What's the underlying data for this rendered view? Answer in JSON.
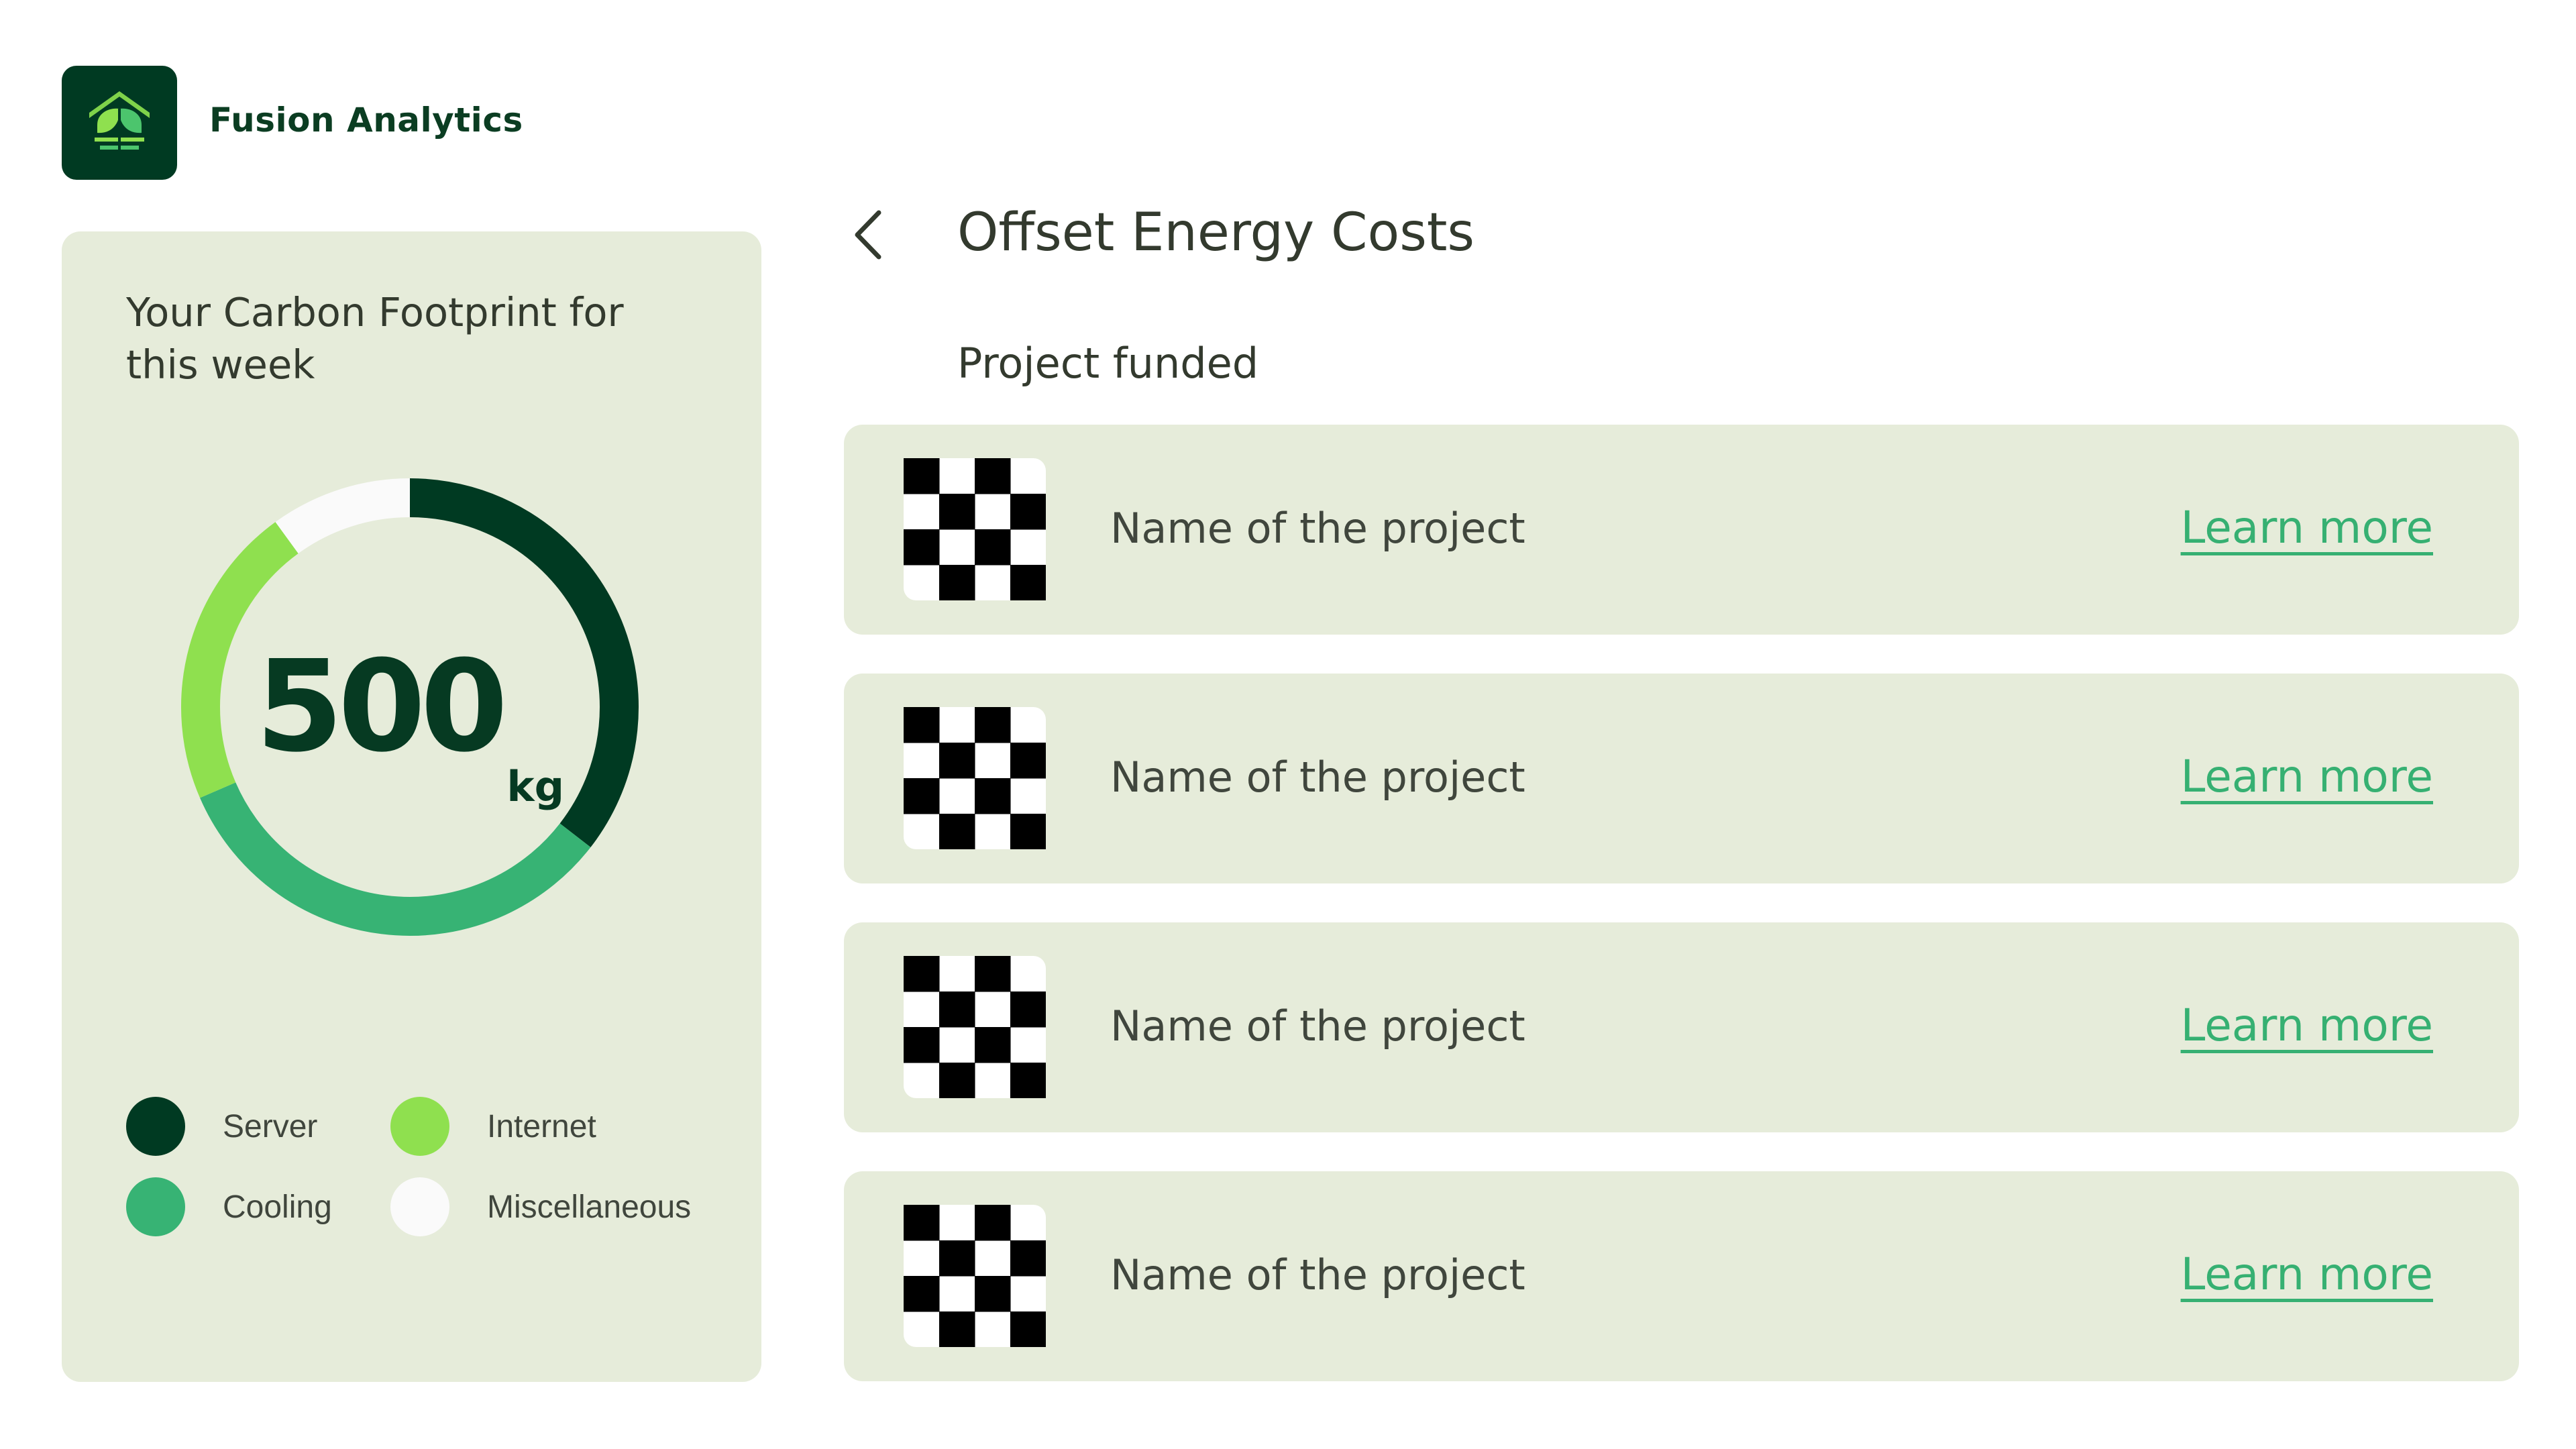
{
  "app": {
    "name": "Fusion Analytics",
    "logo_icon": "leaf-logo-icon"
  },
  "footprint": {
    "title": "Your Carbon Footprint for this week",
    "total": "500",
    "unit": "kg",
    "segments": [
      {
        "name": "Server",
        "fraction": 0.355,
        "color": "#003a22"
      },
      {
        "name": "Cooling",
        "fraction": 0.33,
        "color": "#37b374"
      },
      {
        "name": "Internet",
        "fraction": 0.215,
        "color": "#8fe04f"
      },
      {
        "name": "Miscellaneous",
        "fraction": 0.1,
        "color": "#fafafa"
      }
    ]
  },
  "legend": [
    {
      "label": "Server",
      "color": "#003a22"
    },
    {
      "label": "Internet",
      "color": "#8fe04f"
    },
    {
      "label": "Cooling",
      "color": "#37b374"
    },
    {
      "label": "Miscellaneous",
      "color": "#fafafa"
    }
  ],
  "page": {
    "back_icon": "chevron-left-icon",
    "title": "Offset Energy Costs",
    "section_label": "Project funded"
  },
  "projects": [
    {
      "name": "Name of the project",
      "link": "Learn more",
      "thumb_icon": "placeholder-image-icon"
    },
    {
      "name": "Name of the project",
      "link": "Learn more",
      "thumb_icon": "placeholder-image-icon"
    },
    {
      "name": "Name of the project",
      "link": "Learn more",
      "thumb_icon": "placeholder-image-icon"
    },
    {
      "name": "Name of the project",
      "link": "Learn more",
      "thumb_icon": "placeholder-image-icon"
    }
  ],
  "colors": {
    "accent": "#36b072",
    "card": "#e6ecda",
    "dark": "#003a22"
  }
}
